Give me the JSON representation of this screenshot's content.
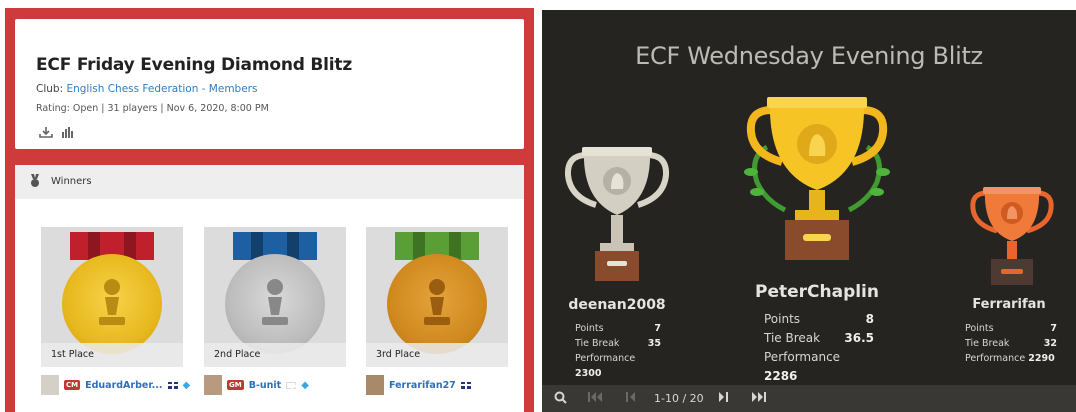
{
  "left": {
    "title": "ECF Friday Evening Diamond Blitz",
    "club_prefix": "Club: ",
    "club_link": "English Chess Federation - Members",
    "rating": "Rating: Open | 31 players | Nov 6, 2020, 8:00 PM",
    "icons": [
      "download-icon",
      "chart-icon"
    ],
    "winners_label": "Winners",
    "places": [
      {
        "label": "1st Place",
        "player": "EduardArber...",
        "title": "CM",
        "color": "#f2c230"
      },
      {
        "label": "2nd Place",
        "player": "B-unit",
        "title": "GM",
        "color": "#b8b8b8"
      },
      {
        "label": "3rd Place",
        "player": "Ferrarifan27",
        "title": "",
        "color": "#d68b1e"
      }
    ]
  },
  "right": {
    "title": "ECF Wednesday Evening Blitz",
    "labels": {
      "points": "Points",
      "tiebreak": "Tie Break",
      "performance": "Performance"
    },
    "podium": [
      {
        "name": "deenan2008",
        "points": "7",
        "tiebreak": "35",
        "performance": "2300"
      },
      {
        "name": "PeterChaplin",
        "points": "8",
        "tiebreak": "36.5",
        "performance": "2286"
      },
      {
        "name": "Ferrarifan",
        "points": "7",
        "tiebreak": "32",
        "performance": "2290"
      }
    ],
    "pagination": "1-10 / 20"
  }
}
